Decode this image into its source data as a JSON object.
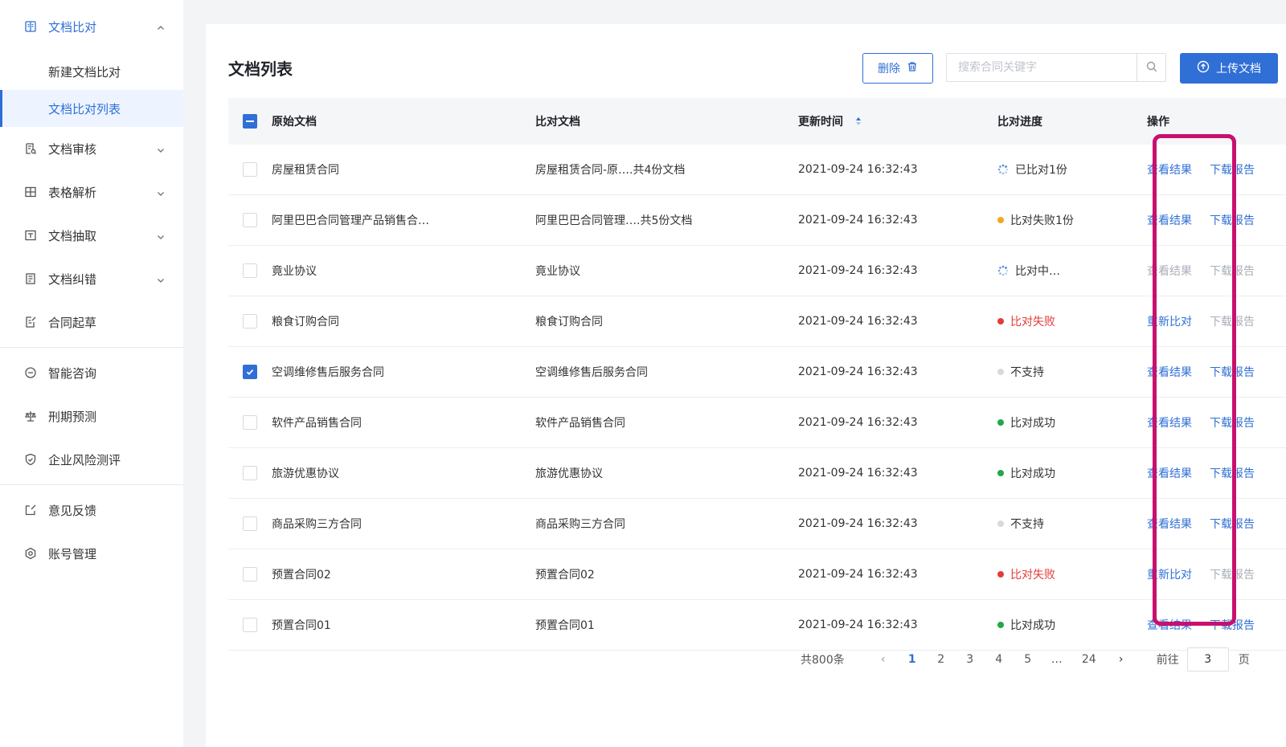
{
  "sidebar": {
    "groups": [
      {
        "label": "文档比对",
        "icon": "compare-doc-icon",
        "expanded": true,
        "children": [
          {
            "label": "新建文档比对",
            "active": false
          },
          {
            "label": "文档比对列表",
            "active": true
          }
        ]
      },
      {
        "label": "文档审核",
        "icon": "review-doc-icon",
        "expanded": false
      },
      {
        "label": "表格解析",
        "icon": "table-icon",
        "expanded": false
      },
      {
        "label": "文档抽取",
        "icon": "extract-icon",
        "expanded": false
      },
      {
        "label": "文档纠错",
        "icon": "correction-icon",
        "expanded": false
      },
      {
        "label": "合同起草",
        "icon": "draft-icon",
        "expanded": null
      }
    ],
    "group2": [
      {
        "label": "智能咨询",
        "icon": "chat-icon"
      },
      {
        "label": "刑期预测",
        "icon": "scale-icon"
      },
      {
        "label": "企业风险测评",
        "icon": "shield-icon"
      }
    ],
    "group3": [
      {
        "label": "意见反馈",
        "icon": "feedback-icon"
      },
      {
        "label": "账号管理",
        "icon": "gear-icon"
      }
    ]
  },
  "main": {
    "title": "文档列表",
    "delete_label": "删除",
    "search_placeholder": "搜索合同关键字",
    "upload_label": "上传文档"
  },
  "table": {
    "headers": {
      "original": "原始文档",
      "compare": "比对文档",
      "updated": "更新时间",
      "progress": "比对进度",
      "ops": "操作"
    },
    "rows": [
      {
        "checked": false,
        "original": "房屋租赁合同",
        "compare": "房屋租赁合同-原….共4份文档",
        "time": "2021-09-24 16:32:43",
        "status": "已比对1份",
        "status_type": "loading",
        "op1": "查看结果",
        "op1_enabled": true,
        "op2": "下载报告",
        "op2_enabled": true
      },
      {
        "checked": false,
        "original": "阿里巴巴合同管理产品销售合…",
        "compare": "阿里巴巴合同管理….共5份文档",
        "time": "2021-09-24 16:32:43",
        "status": "比对失败1份",
        "status_type": "warning",
        "op1": "查看结果",
        "op1_enabled": true,
        "op2": "下载报告",
        "op2_enabled": true
      },
      {
        "checked": false,
        "original": "竟业协议",
        "compare": "竟业协议",
        "time": "2021-09-24 16:32:43",
        "status": "比对中…",
        "status_type": "loading",
        "op1": "查看结果",
        "op1_enabled": false,
        "op2": "下载报告",
        "op2_enabled": false
      },
      {
        "checked": false,
        "original": "粮食订购合同",
        "compare": "粮食订购合同",
        "time": "2021-09-24 16:32:43",
        "status": "比对失败",
        "status_type": "error",
        "op1": "重新比对",
        "op1_enabled": true,
        "op2": "下载报告",
        "op2_enabled": false
      },
      {
        "checked": true,
        "original": "空调维修售后服务合同",
        "compare": "空调维修售后服务合同",
        "time": "2021-09-24 16:32:43",
        "status": "不支持",
        "status_type": "neutral",
        "op1": "查看结果",
        "op1_enabled": true,
        "op2": "下载报告",
        "op2_enabled": true
      },
      {
        "checked": false,
        "original": "软件产品销售合同",
        "compare": "软件产品销售合同",
        "time": "2021-09-24 16:32:43",
        "status": "比对成功",
        "status_type": "success",
        "op1": "查看结果",
        "op1_enabled": true,
        "op2": "下载报告",
        "op2_enabled": true
      },
      {
        "checked": false,
        "original": "旅游优惠协议",
        "compare": "旅游优惠协议",
        "time": "2021-09-24 16:32:43",
        "status": "比对成功",
        "status_type": "success",
        "op1": "查看结果",
        "op1_enabled": true,
        "op2": "下载报告",
        "op2_enabled": true
      },
      {
        "checked": false,
        "original": "商品采购三方合同",
        "compare": "商品采购三方合同",
        "time": "2021-09-24 16:32:43",
        "status": "不支持",
        "status_type": "neutral",
        "op1": "查看结果",
        "op1_enabled": true,
        "op2": "下载报告",
        "op2_enabled": true
      },
      {
        "checked": false,
        "original": "预置合同02",
        "compare": "预置合同02",
        "time": "2021-09-24 16:32:43",
        "status": "比对失败",
        "status_type": "error",
        "op1": "重新比对",
        "op1_enabled": true,
        "op2": "下载报告",
        "op2_enabled": false
      },
      {
        "checked": false,
        "original": "预置合同01",
        "compare": "预置合同01",
        "time": "2021-09-24 16:32:43",
        "status": "比对成功",
        "status_type": "success",
        "op1": "查看结果",
        "op1_enabled": true,
        "op2": "下载报告",
        "op2_enabled": true
      }
    ]
  },
  "pagination": {
    "total": "共800条",
    "pages": [
      "1",
      "2",
      "3",
      "4",
      "5",
      "…",
      "24"
    ],
    "current": "1",
    "goto_label": "前往",
    "goto_value": "3",
    "page_suffix": "页"
  },
  "colors": {
    "accent": "#2f6fd6",
    "success": "#22a845",
    "warning": "#f5a623",
    "error": "#e23c39",
    "neutral": "#d6d9de",
    "highlight": "#c8106f"
  }
}
